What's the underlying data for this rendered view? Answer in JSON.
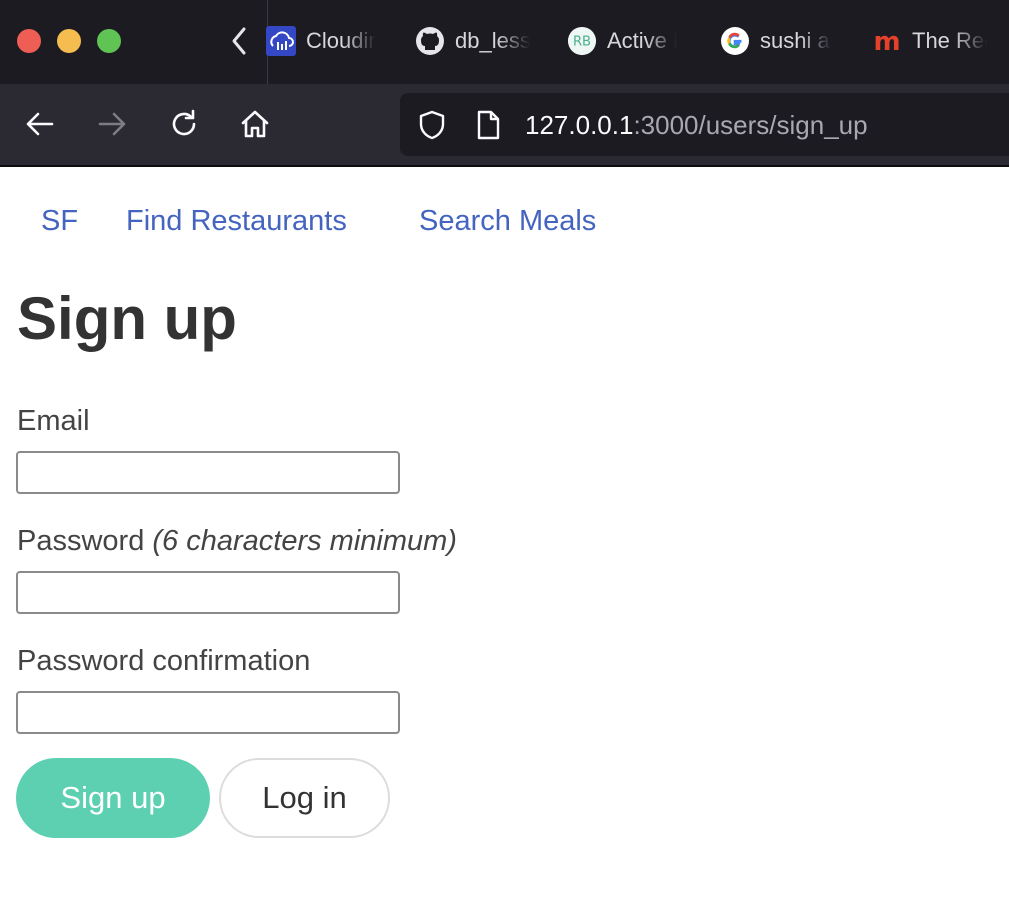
{
  "browser": {
    "tabs": [
      {
        "label": "Cloudinary",
        "icon": "cloudinary-icon"
      },
      {
        "label": "db_lesson",
        "icon": "github-icon"
      },
      {
        "label": "Active Record",
        "icon": "rb-icon",
        "icon_text": "RB"
      },
      {
        "label": "sushi and",
        "icon": "google-icon"
      },
      {
        "label": "The Recipe",
        "icon": "m-icon",
        "icon_text": "m"
      }
    ],
    "url": {
      "host": "127.0.0.1",
      "rest": ":3000/users/sign_up"
    }
  },
  "page": {
    "nav": {
      "city": "SF",
      "find_restaurants": "Find Restaurants",
      "search_meals": "Search Meals"
    },
    "title": "Sign up",
    "form": {
      "email_label": "Email",
      "email_value": "",
      "password_label": "Password",
      "password_hint": "(6 characters minimum)",
      "password_value": "",
      "confirmation_label": "Password confirmation",
      "confirmation_value": "",
      "submit_label": "Sign up",
      "login_label": "Log in"
    }
  },
  "colors": {
    "link": "#4464bf",
    "primary_button": "#5dd0b2",
    "heading": "#333333"
  }
}
